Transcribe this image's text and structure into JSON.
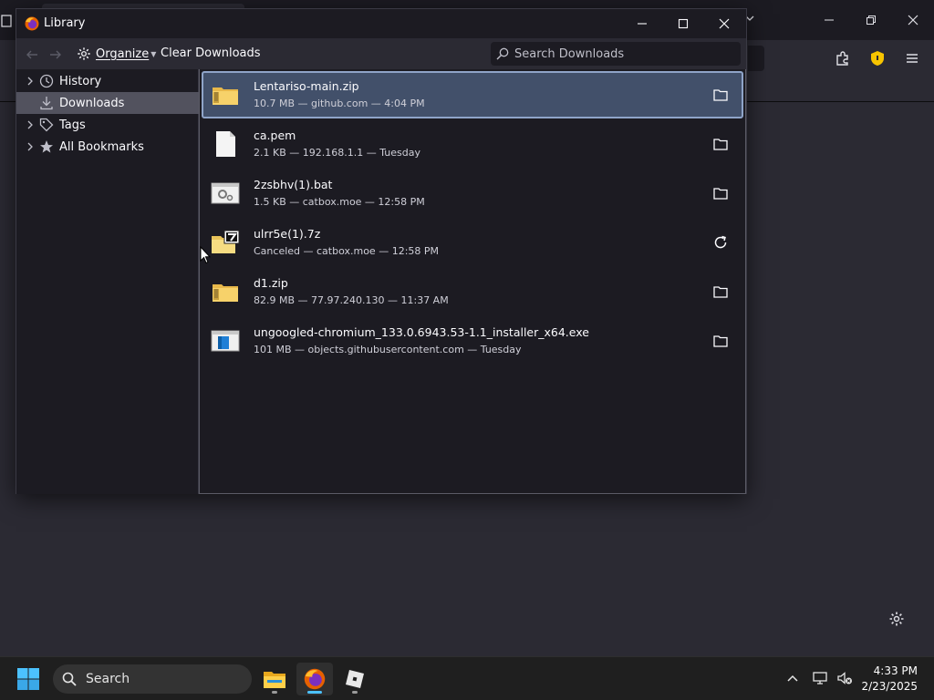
{
  "library": {
    "title": "Library",
    "toolbar": {
      "organize_label": "Organize",
      "clear_label": "Clear Downloads",
      "search_placeholder": "Search Downloads"
    },
    "sidebar": {
      "items": [
        {
          "label": "History",
          "icon": "clock-icon",
          "expandable": true,
          "selected": false
        },
        {
          "label": "Downloads",
          "icon": "download-icon",
          "expandable": false,
          "selected": true
        },
        {
          "label": "Tags",
          "icon": "tag-icon",
          "expandable": true,
          "selected": false
        },
        {
          "label": "All Bookmarks",
          "icon": "star-icon",
          "expandable": true,
          "selected": false
        }
      ]
    },
    "downloads": [
      {
        "name": "Lentariso-main.zip",
        "meta": "10.7 MB — github.com — 4:04 PM",
        "icon": "zip-folder-icon",
        "action": "open-folder",
        "selected": true
      },
      {
        "name": "ca.pem",
        "meta": "2.1 KB — 192.168.1.1 — Tuesday",
        "icon": "file-icon",
        "action": "open-folder",
        "selected": false
      },
      {
        "name": "2zsbhv(1).bat",
        "meta": "1.5 KB — catbox.moe — 12:58 PM",
        "icon": "batch-file-icon",
        "action": "open-folder",
        "selected": false
      },
      {
        "name": "ulrr5e(1).7z",
        "meta": "Canceled — catbox.moe — 12:58 PM",
        "icon": "7z-archive-icon",
        "action": "retry",
        "selected": false
      },
      {
        "name": "d1.zip",
        "meta": "82.9 MB — 77.97.240.130 — 11:37 AM",
        "icon": "zip-folder-icon",
        "action": "open-folder",
        "selected": false
      },
      {
        "name": "ungoogled-chromium_133.0.6943.53-1.1_installer_x64.exe",
        "meta": "101 MB — objects.githubusercontent.com — Tuesday",
        "icon": "installer-icon",
        "action": "open-folder",
        "selected": false
      }
    ]
  },
  "taskbar": {
    "search_label": "Search",
    "time": "4:33 PM",
    "date": "2/23/2025",
    "apps": [
      "file-explorer-icon",
      "firefox-icon",
      "roblox-icon"
    ]
  },
  "colors": {
    "accent_selected": "#42506a",
    "selected_border": "#8fa4c8",
    "sidebar_selected": "#52525e",
    "shield_yellow": "#f7c400"
  }
}
